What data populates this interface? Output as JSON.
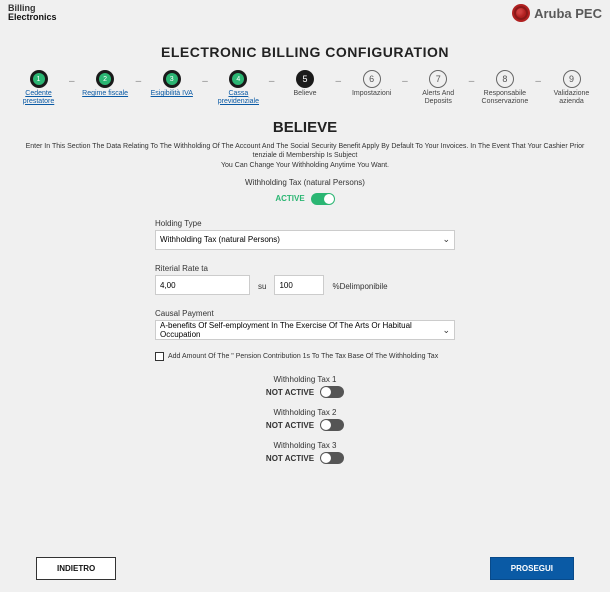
{
  "header": {
    "line1": "Billing",
    "line2": "Electronics",
    "brand": "Aruba PEC"
  },
  "title": "ELECTRONIC BILLING CONFIGURATION",
  "steps": [
    {
      "num": "1",
      "label": "Cedente prestatore",
      "state": "done"
    },
    {
      "num": "2",
      "label": "Regime fiscale",
      "state": "done"
    },
    {
      "num": "3",
      "label": "Esigibilità IVA",
      "state": "done"
    },
    {
      "num": "4",
      "label": "Cassa previdenziale",
      "state": "done"
    },
    {
      "num": "5",
      "label": "Believe",
      "state": "current"
    },
    {
      "num": "6",
      "label": "Impostazioni",
      "state": "future"
    },
    {
      "num": "7",
      "label": "Alerts And Deposits",
      "state": "future"
    },
    {
      "num": "8",
      "label": "Responsabile Conservazione",
      "state": "future"
    },
    {
      "num": "9",
      "label": "Validazione azienda",
      "state": "future"
    }
  ],
  "section": {
    "title": "BELIEVE",
    "intro": "Enter In This Section The Data Relating To The Withholding Of The Account And The Social Security Benefit Apply By Default To Your Invoices. In The Event That Your Cashier Prior tenziale di Membership Is Subject",
    "intro2": "You Can Change Your Withholding Anytime You Want.",
    "subhead": "Withholding Tax (natural Persons)",
    "active_label": "ACTIVE"
  },
  "form": {
    "holding_type_label": "Holding Type",
    "holding_type_value": "Withholding Tax (natural Persons)",
    "rate_label": "Riterial Rate ta",
    "rate_value": "4,00",
    "su_label": "su",
    "su_value": "100",
    "pct_label": "%Delimponibile",
    "causal_label": "Causal Payment",
    "causal_value": "A-benefits Of Self-employment In The Exercise Of The Arts Or Habitual Occupation",
    "checkbox_label": "Add Amount Of The \" Pension Contribution 1s To The Tax Base Of The Withholding Tax"
  },
  "wt": [
    {
      "title": "Withholding Tax 1",
      "status": "NOT ACTIVE"
    },
    {
      "title": "Withholding Tax 2",
      "status": "NOT ACTIVE"
    },
    {
      "title": "Withholding Tax 3",
      "status": "NOT ACTIVE"
    }
  ],
  "buttons": {
    "back": "INDIETRO",
    "next": "PROSEGUI"
  }
}
